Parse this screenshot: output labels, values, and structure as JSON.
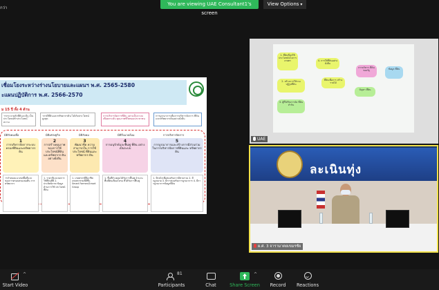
{
  "top": {
    "share_notice": "You are viewing UAE Consultant1's screen",
    "view_options": "View Options",
    "left_label": "กว่า"
  },
  "slide": {
    "title_line1": "เชื่อมโยงระหว่างร่างนโยบายและแผนฯ พ.ศ. 2565-2580",
    "title_line2": "ะแผนปฏิบัติการ พ.ศ. 2566-2570",
    "subtitle": "ม 15 ปี ทั้ง 4 ด้าน",
    "goals": [
      "ารกระจายตัวที่ดินจะมีรู เป็นประโยชน์ท้าประโยชน์ ความ",
      "ากรมีที่ดินและทรัพยากรดิน ได้เกิดประโยชน์สูงสุด",
      "การบริหารจัดการที่ดิน อย่างเป็นระบบ เพื่อยกระดับ คุณภาพชีวิตของประชาชน",
      "การบูรณาการเพื่อการบริหารจัดการ ที่ดินและทรัพยากรดินอย่างยั่งยืน"
    ],
    "column_headers": [
      "มิติสังคมเพื่อ",
      "มิติเศรษฐกิจ",
      "มิติสังคม",
      "มิติสิ่งแวดล้อม",
      "การบริหารจัดการ"
    ],
    "cards": [
      {
        "num": "1",
        "text": "การบริหารจัดการระบบ ครองที่ดินและทรัพยากร ดิน"
      },
      {
        "num": "2",
        "text": "การสร้างคุณภาพ ของการใช้ ประโยชน์ที่ดิน และทรัพยากร ดินอย่างยั่งยืน"
      },
      {
        "num": "3",
        "text": "พัฒนาขีด ความสามารถใน การใช้ประโยชน์ ที่ดินและทรัพยากร ดิน"
      },
      {
        "num": "4",
        "text": "การอนุรักษ์และฟื้นฟู ที่ดิน อย่างเป็นระบบ"
      },
      {
        "num": "5",
        "text": "การบูรณาการและสร้างการมีส่วนร่วม ในการบริหารจัดการที่ดินและ ทรัพยากรดิน"
      }
    ],
    "details": [
      "ารกำหนดแนวเขตพื้นที่และ ของการครอบครองบ่อคืน การ ทรัพยากร",
      "1. ราคาดีและลดการใช้ที่ดินที่ดี 2. ประสิทธิภาพ ข้อมูลด้านการใช้ ประโยชน์ที่ดิน",
      "1. เกษตรกรที่มีอาชีพ เกษตรกรรมที่ดีขึ้น Smart Farmer/Smart Group",
      "1. พื้นที่ล้างคลุมได้รับการฟื้นฟู จำนวนพื้นที่ดินเสื่อมโทรม ที่ได้รับการฟื้นฟู",
      "1. มีกลไกเพื่อส่งเสริมการมีส่วนร่วม 2. มีกฎหมาย 3. มีการส่งเสริมการบูรณาการ 4. มีการบูรณาการข้อมูลที่ดิน"
    ]
  },
  "tiles": {
    "top_name": "UAE",
    "notes": [
      "1. ที่ดินที่ถูกใช้ ประโยชน์ทางการเกษตร",
      "2. สร้างการให้รวม ปฏิรูปที่ดิน",
      "3. ผู้ที่ได้รับการจัด ที่ดินทำกิน",
      "4. การใช้ที่ดินอย่าง ยั่งยืน",
      "ที่ดินเพื่อการ สร้างรายได้",
      "การบริหาร ที่ดินของรัฐ",
      "ข้อมูล ที่ดิน",
      "ปัญหา ที่ดิน"
    ],
    "banner_text": "ละเนินทุ่ง",
    "bottom_caption": "ผ.ศ. 3 จารามาตยเขมรชัย"
  },
  "toolbar": {
    "start_video": "Start Video",
    "participants": "Participants",
    "participants_count": "81",
    "chat": "Chat",
    "share_screen": "Share Screen",
    "record": "Record",
    "reactions": "Reactions"
  },
  "colors": {
    "share_green": "#2fb85a",
    "active_speaker": "#f3e24a",
    "slide_frame": "#d62b2b"
  }
}
